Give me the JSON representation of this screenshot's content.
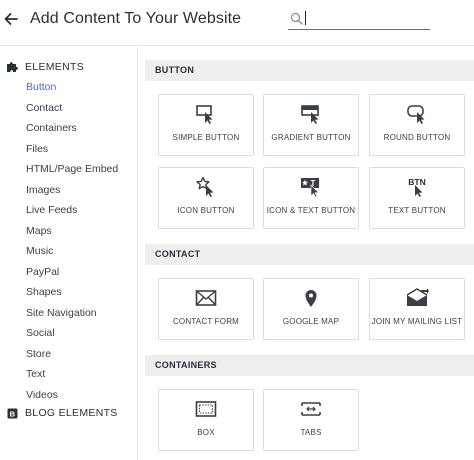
{
  "header": {
    "title": "Add Content To Your Website",
    "search_value": "",
    "accent": "#4a6bd4"
  },
  "sidebar": {
    "elements_heading": "ELEMENTS",
    "items": [
      {
        "label": "Button",
        "active": true
      },
      {
        "label": "Contact"
      },
      {
        "label": "Containers"
      },
      {
        "label": "Files"
      },
      {
        "label": "HTML/Page Embed"
      },
      {
        "label": "Images"
      },
      {
        "label": "Live Feeds"
      },
      {
        "label": "Maps"
      },
      {
        "label": "Music"
      },
      {
        "label": "PayPal"
      },
      {
        "label": "Shapes"
      },
      {
        "label": "Site Navigation"
      },
      {
        "label": "Social"
      },
      {
        "label": "Store"
      },
      {
        "label": "Text"
      },
      {
        "label": "Videos"
      }
    ],
    "blog_heading": "BLOG ELEMENTS",
    "active_color": "#3a6fd8"
  },
  "categories": {
    "button": {
      "title": "BUTTON",
      "tiles": {
        "simple": {
          "label": "SIMPLE BUTTON",
          "icon": "simple-button-icon"
        },
        "gradient": {
          "label": "GRADIENT BUTTON",
          "icon": "gradient-button-icon"
        },
        "round": {
          "label": "ROUND BUTTON",
          "icon": "round-button-icon"
        },
        "icon": {
          "label": "ICON BUTTON",
          "icon": "star-button-icon"
        },
        "icon_text": {
          "label": "ICON & TEXT BUTTON",
          "icon": "icon-text-button-icon"
        },
        "text": {
          "label": "TEXT BUTTON",
          "icon_text": "BTN"
        }
      }
    },
    "contact": {
      "title": "CONTACT",
      "tiles": {
        "form": {
          "label": "CONTACT FORM",
          "icon": "envelope-icon"
        },
        "map": {
          "label": "GOOGLE MAP",
          "icon": "map-pin-icon"
        },
        "mailing": {
          "label": "JOIN MY MAILING LIST",
          "icon": "mailing-list-icon"
        }
      }
    },
    "containers": {
      "title": "CONTAINERS",
      "tiles": {
        "box": {
          "label": "BOX",
          "icon": "box-icon"
        },
        "tabs": {
          "label": "TABS",
          "icon": "tabs-icon"
        }
      }
    }
  }
}
